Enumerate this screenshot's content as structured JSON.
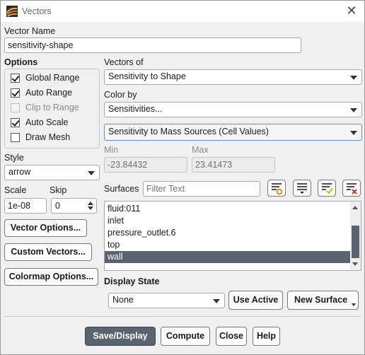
{
  "window": {
    "title": "Vectors"
  },
  "vector_name": {
    "label": "Vector Name",
    "value": "sensitivity-shape"
  },
  "options": {
    "label": "Options",
    "items": [
      {
        "label": "Global Range",
        "checked": true,
        "disabled": false
      },
      {
        "label": "Auto Range",
        "checked": true,
        "disabled": false
      },
      {
        "label": "Clip to Range",
        "checked": false,
        "disabled": true
      },
      {
        "label": "Auto Scale",
        "checked": true,
        "disabled": false
      },
      {
        "label": "Draw Mesh",
        "checked": false,
        "disabled": false
      }
    ]
  },
  "style": {
    "label": "Style",
    "value": "arrow"
  },
  "scale": {
    "label": "Scale",
    "value": "1e-08"
  },
  "skip": {
    "label": "Skip",
    "value": "0"
  },
  "buttons_left": {
    "vector_options": "Vector Options...",
    "custom_vectors": "Custom Vectors...",
    "colormap_options": "Colormap Options..."
  },
  "vectors_of": {
    "label": "Vectors of",
    "value": "Sensitivity to Shape"
  },
  "color_by": {
    "label": "Color by",
    "category": "Sensitivities...",
    "field": "Sensitivity to Mass Sources (Cell Values)"
  },
  "range": {
    "min_label": "Min",
    "min_value": "-23.84432",
    "max_label": "Max",
    "max_value": "23.41473"
  },
  "surfaces": {
    "label": "Surfaces",
    "filter_placeholder": "Filter Text",
    "items": [
      "fluid:011",
      "inlet",
      "pressure_outlet.6",
      "top",
      "wall"
    ],
    "selected_index": 4
  },
  "display_state": {
    "label": "Display State",
    "value": "None",
    "use_active": "Use Active",
    "new_surface": "New Surface"
  },
  "footer": {
    "save_display": "Save/Display",
    "compute": "Compute",
    "close": "Close",
    "help": "Help"
  },
  "colors": {
    "accent": "#5a6470",
    "check_yellow": "#e8b600",
    "filter_orange": "#e07a00",
    "clear_red": "#c0392b"
  }
}
